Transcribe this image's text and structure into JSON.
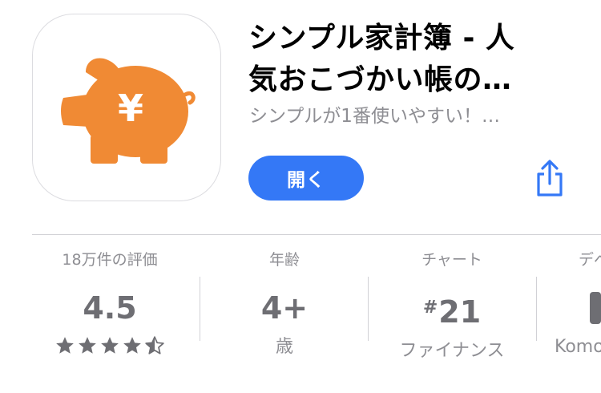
{
  "app": {
    "title_line1": "シンプル家計簿 - 人",
    "title_line2": "気おこづかい帳の…",
    "subtitle": "シンプルが1番使いやすい！…",
    "open_label": "開く",
    "icon_symbol": "¥",
    "icon_color": "#f08a34",
    "accent_color": "#3478f6"
  },
  "stats": {
    "ratings": {
      "header": "18万件の評価",
      "value": "4.5",
      "stars": 4.5
    },
    "age": {
      "header": "年齢",
      "value": "4+",
      "sub": "歳"
    },
    "chart": {
      "header": "チャート",
      "value_prefix": "#",
      "value": "21",
      "sub": "ファイナンス"
    },
    "developer": {
      "header": "デベ",
      "sub": "Komo"
    }
  },
  "icons": [
    "piggy-bank-yen-icon",
    "share-icon",
    "star-icon",
    "half-star-icon",
    "person-icon"
  ]
}
